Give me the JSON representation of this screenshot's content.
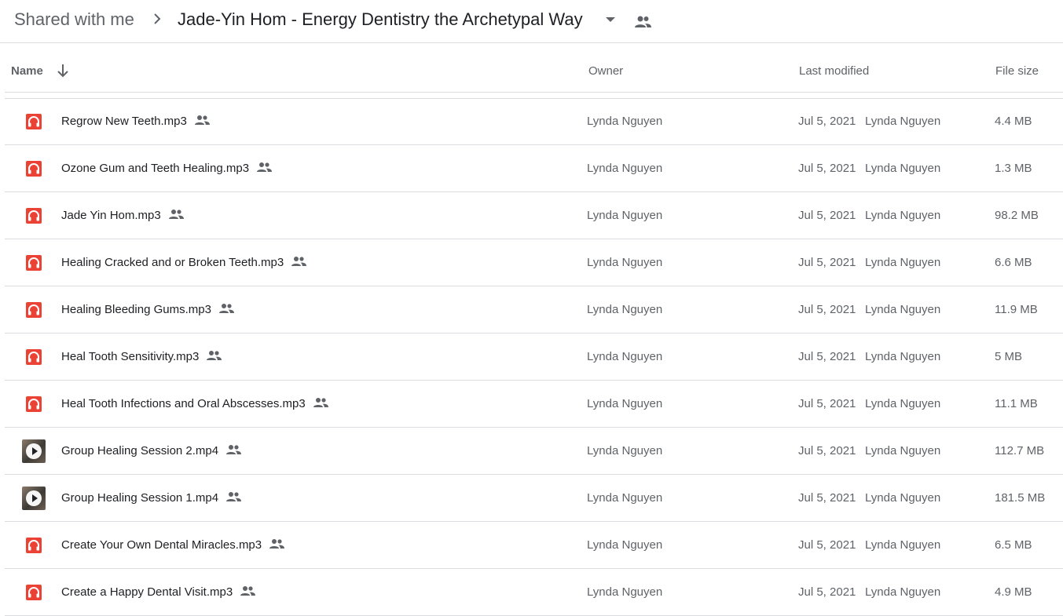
{
  "breadcrumb": {
    "root": "Shared with me",
    "current": "Jade-Yin Hom - Energy Dentistry the Archetypal Way"
  },
  "columns": {
    "name": "Name",
    "owner": "Owner",
    "last_modified": "Last modified",
    "file_size": "File size"
  },
  "colors": {
    "audio_icon": "#ea4335",
    "text_primary": "#202124",
    "text_secondary": "#5f6368",
    "divider": "#dadce0"
  },
  "files": [
    {
      "name": "Regrow New Teeth.mp3",
      "type": "audio",
      "icon": "headphones-icon",
      "owner": "Lynda Nguyen",
      "date": "Jul 5, 2021",
      "modified_by": "Lynda Nguyen",
      "size": "4.4 MB"
    },
    {
      "name": "Ozone Gum and Teeth Healing.mp3",
      "type": "audio",
      "icon": "headphones-icon",
      "owner": "Lynda Nguyen",
      "date": "Jul 5, 2021",
      "modified_by": "Lynda Nguyen",
      "size": "1.3 MB"
    },
    {
      "name": "Jade Yin Hom.mp3",
      "type": "audio",
      "icon": "headphones-icon",
      "owner": "Lynda Nguyen",
      "date": "Jul 5, 2021",
      "modified_by": "Lynda Nguyen",
      "size": "98.2 MB"
    },
    {
      "name": "Healing Cracked and or Broken Teeth.mp3",
      "type": "audio",
      "icon": "headphones-icon",
      "owner": "Lynda Nguyen",
      "date": "Jul 5, 2021",
      "modified_by": "Lynda Nguyen",
      "size": "6.6 MB"
    },
    {
      "name": "Healing Bleeding Gums.mp3",
      "type": "audio",
      "icon": "headphones-icon",
      "owner": "Lynda Nguyen",
      "date": "Jul 5, 2021",
      "modified_by": "Lynda Nguyen",
      "size": "11.9 MB"
    },
    {
      "name": "Heal Tooth Sensitivity.mp3",
      "type": "audio",
      "icon": "headphones-icon",
      "owner": "Lynda Nguyen",
      "date": "Jul 5, 2021",
      "modified_by": "Lynda Nguyen",
      "size": "5 MB"
    },
    {
      "name": "Heal Tooth Infections and Oral Abscesses.mp3",
      "type": "audio",
      "icon": "headphones-icon",
      "owner": "Lynda Nguyen",
      "date": "Jul 5, 2021",
      "modified_by": "Lynda Nguyen",
      "size": "11.1 MB"
    },
    {
      "name": "Group Healing Session 2.mp4",
      "type": "video",
      "icon": "video-thumbnail-icon",
      "owner": "Lynda Nguyen",
      "date": "Jul 5, 2021",
      "modified_by": "Lynda Nguyen",
      "size": "112.7 MB"
    },
    {
      "name": "Group Healing Session 1.mp4",
      "type": "video",
      "icon": "video-thumbnail-icon",
      "owner": "Lynda Nguyen",
      "date": "Jul 5, 2021",
      "modified_by": "Lynda Nguyen",
      "size": "181.5 MB"
    },
    {
      "name": "Create Your Own Dental Miracles.mp3",
      "type": "audio",
      "icon": "headphones-icon",
      "owner": "Lynda Nguyen",
      "date": "Jul 5, 2021",
      "modified_by": "Lynda Nguyen",
      "size": "6.5 MB"
    },
    {
      "name": "Create a Happy Dental Visit.mp3",
      "type": "audio",
      "icon": "headphones-icon",
      "owner": "Lynda Nguyen",
      "date": "Jul 5, 2021",
      "modified_by": "Lynda Nguyen",
      "size": "4.9 MB"
    }
  ]
}
